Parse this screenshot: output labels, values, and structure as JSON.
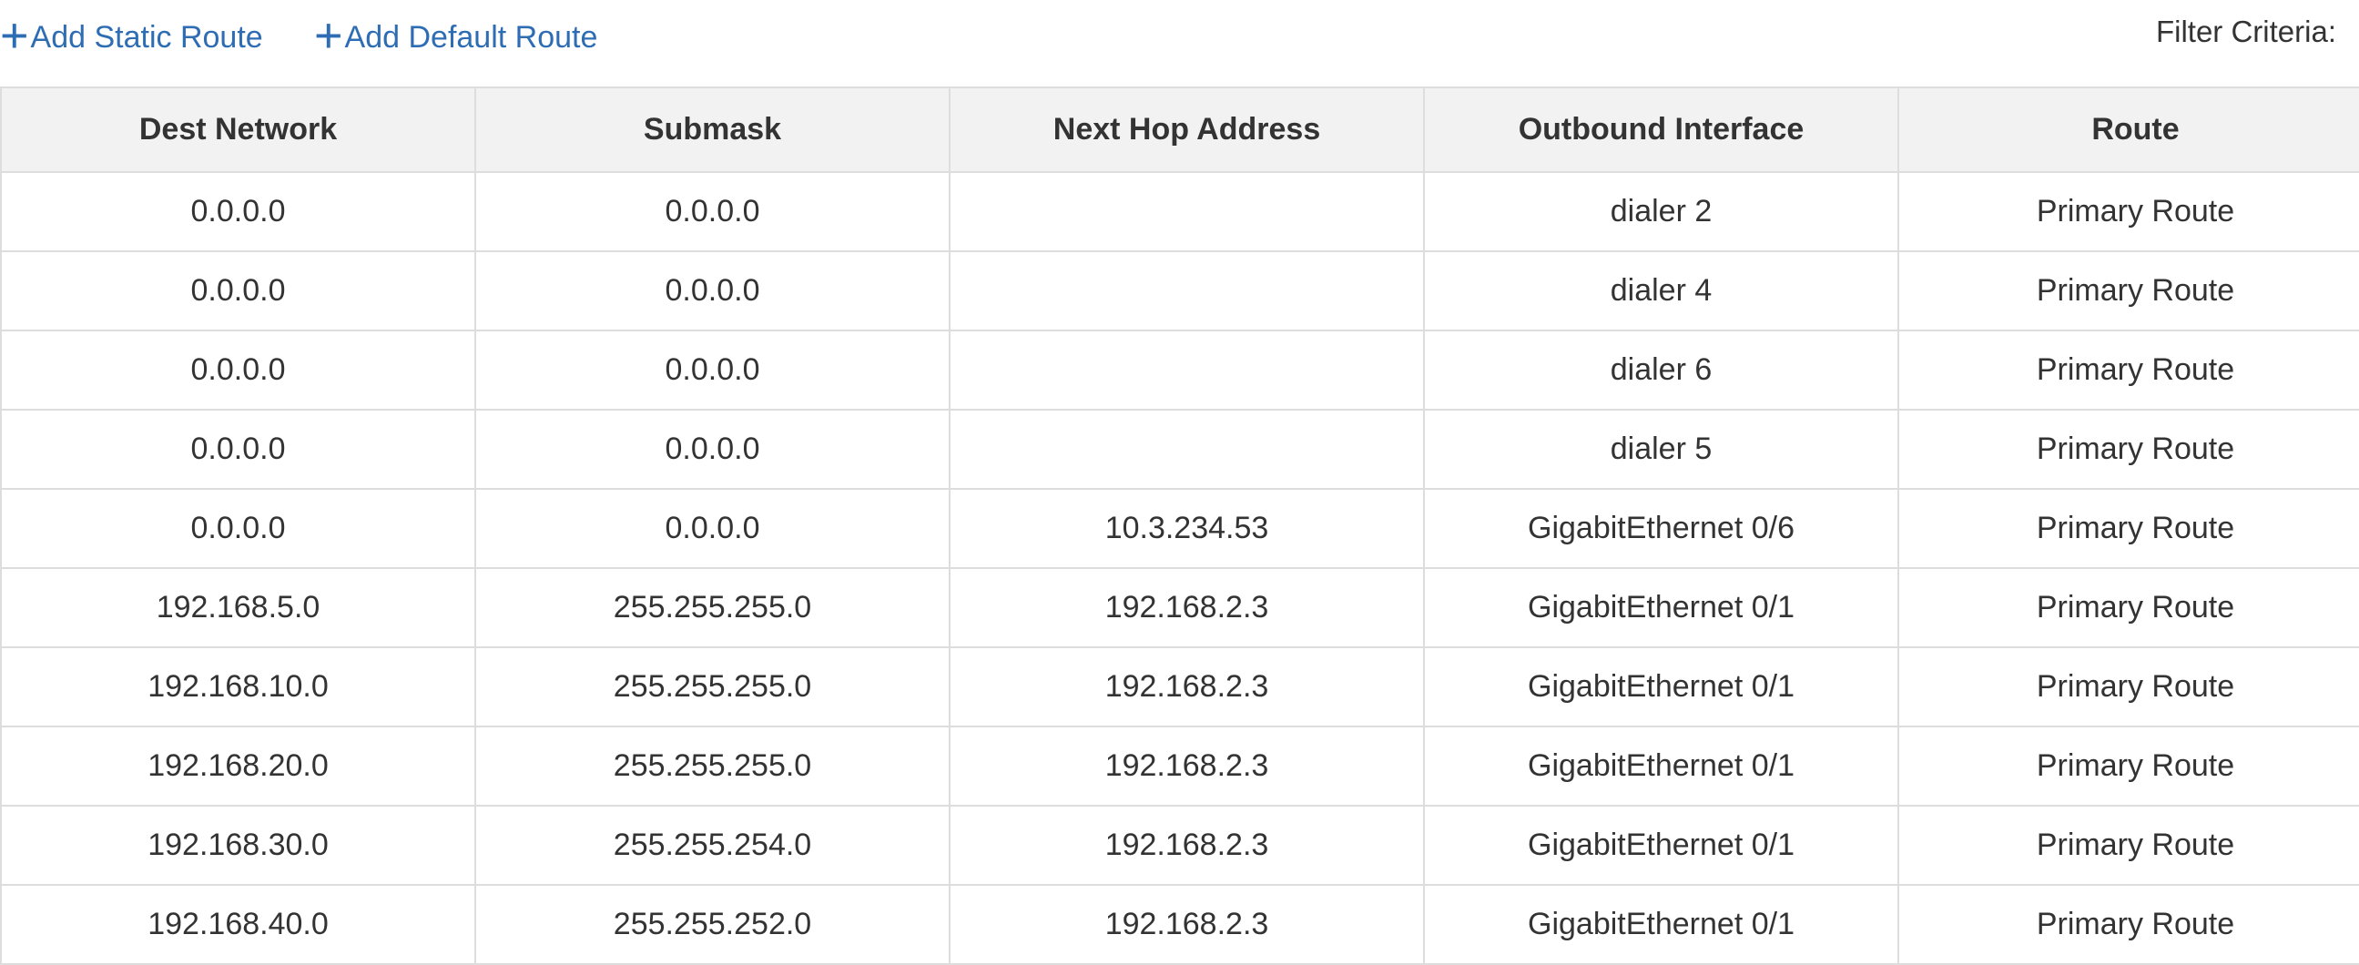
{
  "toolbar": {
    "add_static_route": "Add Static Route",
    "add_default_route": "Add Default Route",
    "filter_label": "Filter Criteria:"
  },
  "table": {
    "headers": [
      "Dest Network",
      "Submask",
      "Next Hop Address",
      "Outbound Interface",
      "Route"
    ],
    "rows": [
      [
        "0.0.0.0",
        "0.0.0.0",
        "",
        "dialer 2",
        "Primary Route"
      ],
      [
        "0.0.0.0",
        "0.0.0.0",
        "",
        "dialer 4",
        "Primary Route"
      ],
      [
        "0.0.0.0",
        "0.0.0.0",
        "",
        "dialer 6",
        "Primary Route"
      ],
      [
        "0.0.0.0",
        "0.0.0.0",
        "",
        "dialer 5",
        "Primary Route"
      ],
      [
        "0.0.0.0",
        "0.0.0.0",
        "10.3.234.53",
        "GigabitEthernet 0/6",
        "Primary Route"
      ],
      [
        "192.168.5.0",
        "255.255.255.0",
        "192.168.2.3",
        "GigabitEthernet 0/1",
        "Primary Route"
      ],
      [
        "192.168.10.0",
        "255.255.255.0",
        "192.168.2.3",
        "GigabitEthernet 0/1",
        "Primary Route"
      ],
      [
        "192.168.20.0",
        "255.255.255.0",
        "192.168.2.3",
        "GigabitEthernet 0/1",
        "Primary Route"
      ],
      [
        "192.168.30.0",
        "255.255.254.0",
        "192.168.2.3",
        "GigabitEthernet 0/1",
        "Primary Route"
      ],
      [
        "192.168.40.0",
        "255.255.252.0",
        "192.168.2.3",
        "GigabitEthernet 0/1",
        "Primary Route"
      ]
    ]
  }
}
